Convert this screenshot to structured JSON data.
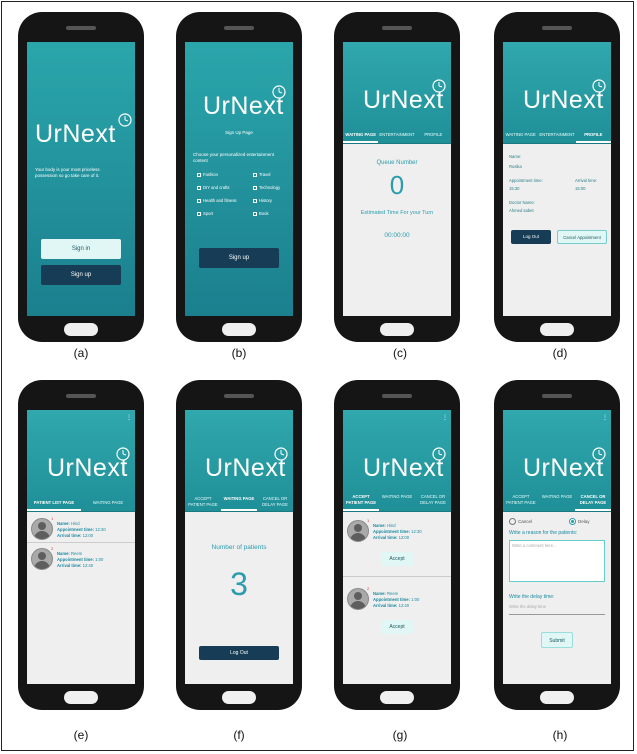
{
  "captions": [
    "(a)",
    "(b)",
    "(c)",
    "(d)",
    "(e)",
    "(f)",
    "(g)",
    "(h)"
  ],
  "logo": "UrNext",
  "a": {
    "tagline": "Your body is your most priceless possession so go take care of it.",
    "signin": "Sign in",
    "signup": "Sign up"
  },
  "b": {
    "title": "Sign Up Page",
    "prompt": "Choose your personalized entertainment content",
    "col1": [
      "Fashion",
      "DIY and crafts",
      "Health and fitness",
      "Sport"
    ],
    "col2": [
      "Travel",
      "Technology",
      "History",
      "Book"
    ],
    "signup": "Sign up"
  },
  "c": {
    "tabs": [
      "WAITING PAGE",
      "ENTERTAINMENT",
      "PROFILE"
    ],
    "queue_label": "Queue Number",
    "queue_number": "0",
    "est_label": "Estimated Time For your Turn",
    "est_time": "00:00:00"
  },
  "d": {
    "tabs": [
      "WAITING PAGE",
      "ENTERTAINMENT",
      "PROFILE"
    ],
    "name_label": "Name:",
    "name_value": "Rusika",
    "appt_label": "Appointment time:",
    "appt_value": "15:30",
    "arrival_label": "Arrival time:",
    "arrival_value": "15:00",
    "doctor_label": "Doctor Name:",
    "doctor_value": "Ahmed sabet",
    "logout": "Log Out",
    "cancel": "Cancel Appointment"
  },
  "e": {
    "tabs": [
      "PATIENT LIST PAGE",
      "WAITING PAGE"
    ],
    "patients": [
      {
        "num": "1",
        "name": "Hind",
        "appt": "12:30",
        "arrival": "12:00"
      },
      {
        "num": "2",
        "name": "Reem",
        "appt": "1:00",
        "arrival": "12:40"
      }
    ],
    "name_label": "Name:",
    "appt_label": "Appointment time:",
    "arrival_label": "Arrival time:"
  },
  "f": {
    "tabs": [
      "ACCEPT PATIENT PAGE",
      "WAITING PAGE",
      "CANCEL OR DELAY PAGE"
    ],
    "label": "Number of patients",
    "count": "3",
    "logout": "Log Out"
  },
  "g": {
    "tabs": [
      "ACCEPT PATIENT PAGE",
      "WAITING PAGE",
      "CANCEL OR DELAY PAGE"
    ],
    "patients": [
      {
        "num": "1",
        "name": "Hind",
        "appt": "12:30",
        "arrival": "12:00"
      },
      {
        "num": "2",
        "name": "Reem",
        "appt": "1:00",
        "arrival": "12:40"
      }
    ],
    "accept": "Accept"
  },
  "h": {
    "tabs": [
      "ACCEPT PATIENT PAGE",
      "WAITING PAGE",
      "CANCEL OR DELAY PAGE"
    ],
    "cancel": "Cancel",
    "delay": "Delay",
    "reason_label": "Write a reason for the patients:",
    "comment_placeholder": "Write a comment here...",
    "delay_label": "Write the delay time:",
    "delay_placeholder": "Write the delay time",
    "submit": "Submit"
  }
}
